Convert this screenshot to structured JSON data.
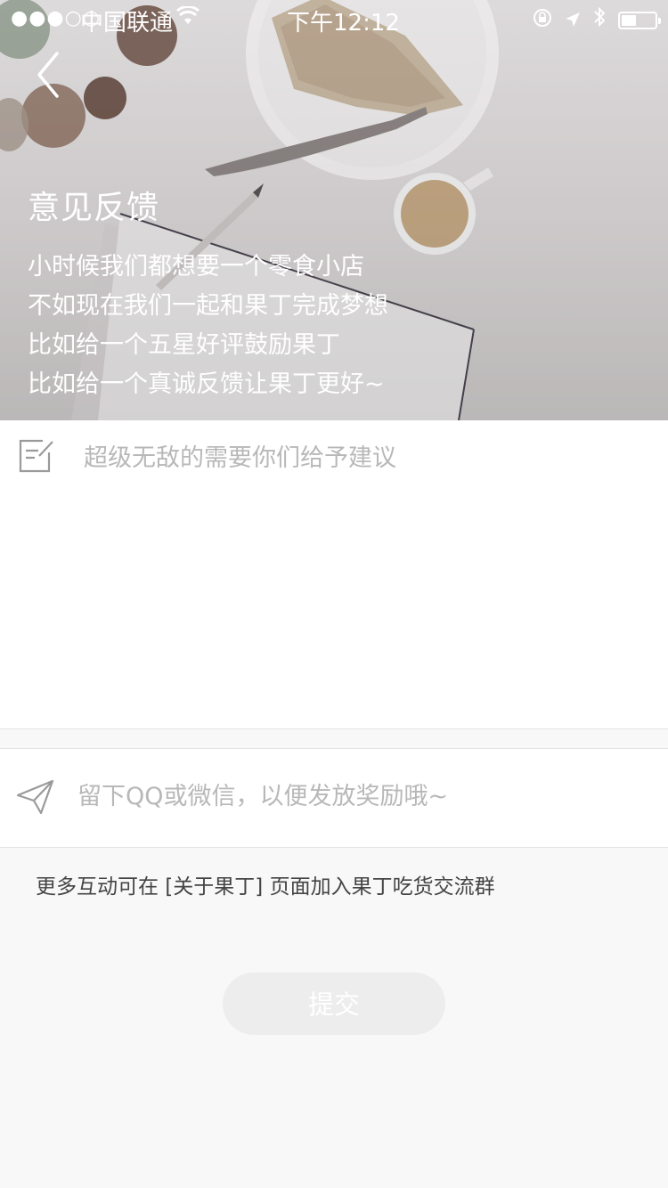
{
  "status_bar": {
    "signal": "●●●○○",
    "carrier": "中国联通",
    "time": "下午12:12",
    "battery_level": 0.45
  },
  "header": {
    "title": "意见反馈",
    "intro_lines": [
      "小时候我们都想要一个零食小店",
      "不如现在我们一起和果丁完成梦想",
      "比如给一个五星好评鼓励果丁",
      "比如给一个真诚反馈让果丁更好~"
    ]
  },
  "feedback": {
    "placeholder": "超级无敌的需要你们给予建议",
    "value": ""
  },
  "contact": {
    "placeholder": "留下QQ或微信，以便发放奖励哦~",
    "value": ""
  },
  "note": "更多互动可在 [关于果丁] 页面加入果丁吃货交流群",
  "submit_label": "提交",
  "icons": {
    "back": "chevron-left-icon",
    "edit": "edit-note-icon",
    "send": "paper-plane-icon",
    "wifi": "wifi-icon",
    "lock_rotation": "orientation-lock-icon",
    "location": "location-arrow-icon",
    "bluetooth": "bluetooth-icon",
    "battery": "battery-icon"
  },
  "colors": {
    "placeholder": "#b8b8b8",
    "submit_bg": "#ededed",
    "page_bg": "#f8f8f8"
  }
}
